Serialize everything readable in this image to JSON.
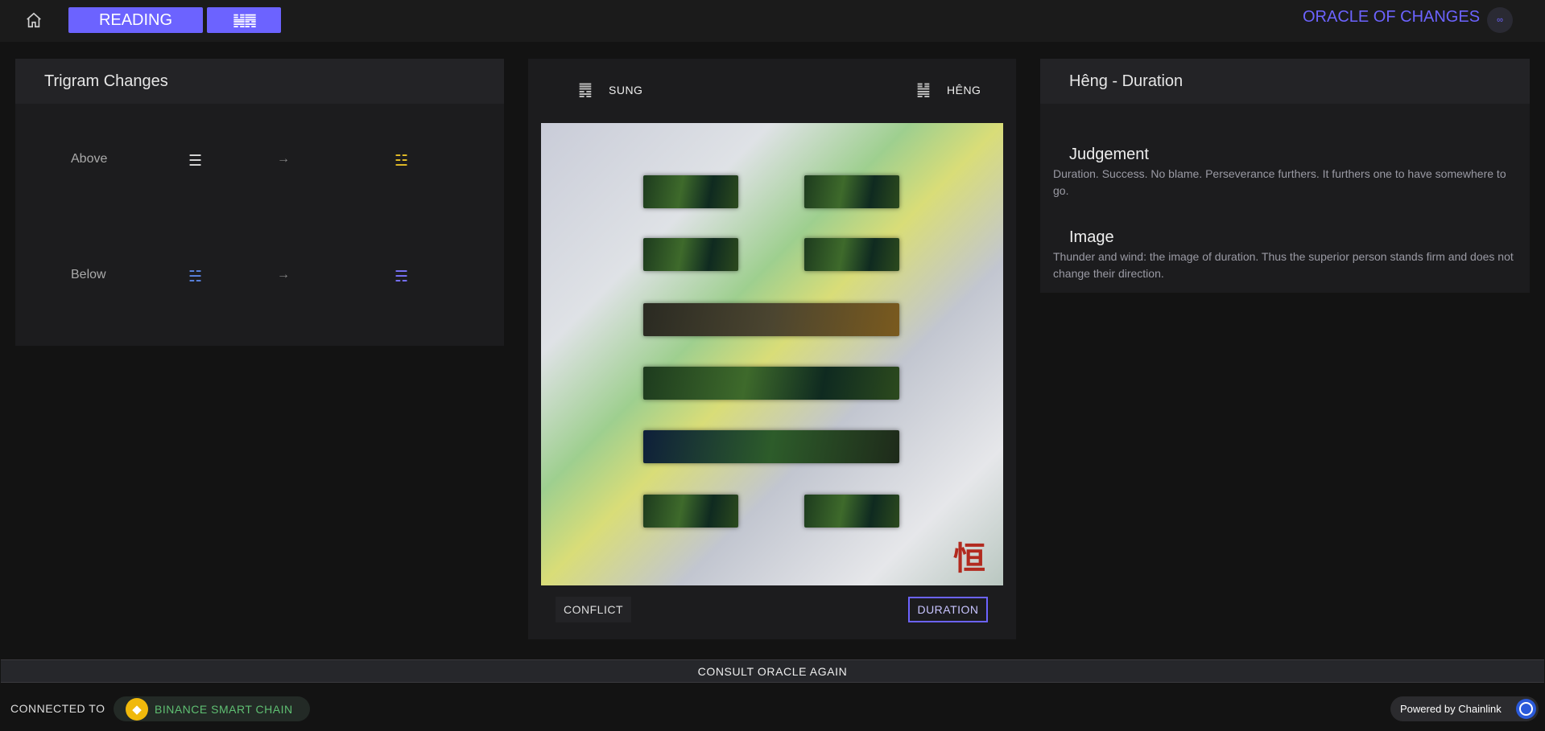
{
  "header": {
    "reading_label": "READING",
    "hexagram_pair_label": "䷟䷅",
    "brand": "ORACLE OF CHANGES",
    "avatar_glyph": "∞"
  },
  "trigram_panel": {
    "title": "Trigram Changes",
    "rows": [
      {
        "label": "Above",
        "from": "☰",
        "arrow": "→",
        "to": "☳",
        "from_color": "#dddddd",
        "to_color": "#e8c127"
      },
      {
        "label": "Below",
        "from": "☵",
        "arrow": "→",
        "to": "☴",
        "from_color": "#5b86e5",
        "to_color": "#7b74ff"
      }
    ]
  },
  "hexagram_panel": {
    "left_glyph": "䷅",
    "left_name": "SUNG",
    "right_glyph": "䷟",
    "right_name": "HÊNG",
    "seal_glyph": "恒",
    "conflict_button": "CONFLICT",
    "duration_button": "DURATION"
  },
  "reading_panel": {
    "title": "Hêng - Duration",
    "judgement_title": "Judgement",
    "judgement_text": "Duration. Success. No blame. Perseverance furthers. It furthers one to have somewhere to go.",
    "image_title": "Image",
    "image_text": "Thunder and wind: the image of duration. Thus the superior person stands firm and does not change their direction."
  },
  "consult_label": "CONSULT ORACLE AGAIN",
  "footer": {
    "connected_label": "CONNECTED TO",
    "chain_name": "BINANCE SMART CHAIN",
    "powered_by": "Powered by Chainlink"
  },
  "colors": {
    "accent": "#6c63ff",
    "chain_green": "#5fbf72",
    "bnb_yellow": "#f0b90b",
    "chainlink_blue": "#2a5ada"
  }
}
